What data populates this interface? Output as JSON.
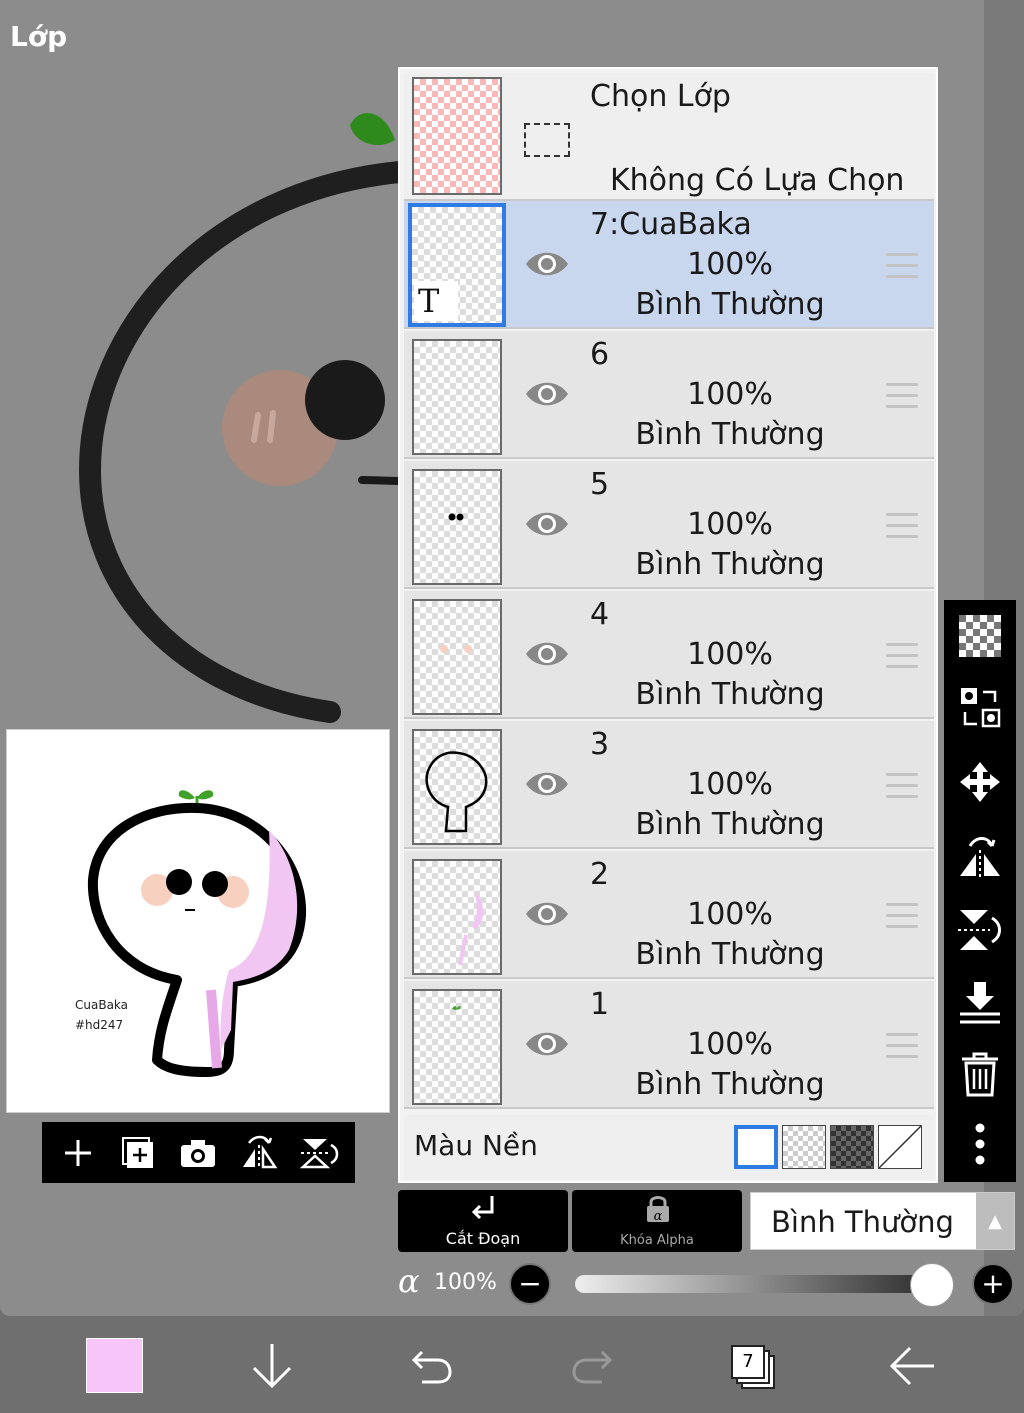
{
  "panel": {
    "title": "Lớp"
  },
  "colors": {
    "accent": "#2e7be3",
    "selected_row": "#c9d7ee",
    "current_color": "#f7c5f7"
  },
  "thumbnail": {
    "caption_line1": "CuaBaka",
    "caption_line2": "#hd247"
  },
  "thumb_toolbar": {
    "icons": [
      "add-layer-icon",
      "add-raster-icon",
      "camera-icon",
      "flip-horizontal-icon",
      "flip-vertical-icon"
    ]
  },
  "selection_row": {
    "title": "Chọn Lớp",
    "subtitle": "Không Có Lựa Chọn"
  },
  "layers": [
    {
      "name": "7:CuaBaka",
      "opacity": "100%",
      "mode": "Bình Thường",
      "selected": true
    },
    {
      "name": "6",
      "opacity": "100%",
      "mode": "Bình Thường",
      "selected": false
    },
    {
      "name": "5",
      "opacity": "100%",
      "mode": "Bình Thường",
      "selected": false
    },
    {
      "name": "4",
      "opacity": "100%",
      "mode": "Bình Thường",
      "selected": false
    },
    {
      "name": "3",
      "opacity": "100%",
      "mode": "Bình Thường",
      "selected": false
    },
    {
      "name": "2",
      "opacity": "100%",
      "mode": "Bình Thường",
      "selected": false
    },
    {
      "name": "1",
      "opacity": "100%",
      "mode": "Bình Thường",
      "selected": false
    }
  ],
  "background_row": {
    "label": "Màu Nền"
  },
  "side_tools": [
    "checkerboard-icon",
    "swap-layer-icon",
    "move-icon",
    "flip-rotate-icon",
    "flip-vertical-rotate-icon",
    "merge-down-icon",
    "trash-icon",
    "more-icon"
  ],
  "options": {
    "clip_label": "Cắt Đoạn",
    "alpha_lock_label": "Khóa Alpha",
    "blend_mode": "Bình Thường"
  },
  "alpha": {
    "symbol": "α",
    "value": "100%",
    "level": 1.0
  },
  "bottom_bar": {
    "layer_count": "7"
  }
}
